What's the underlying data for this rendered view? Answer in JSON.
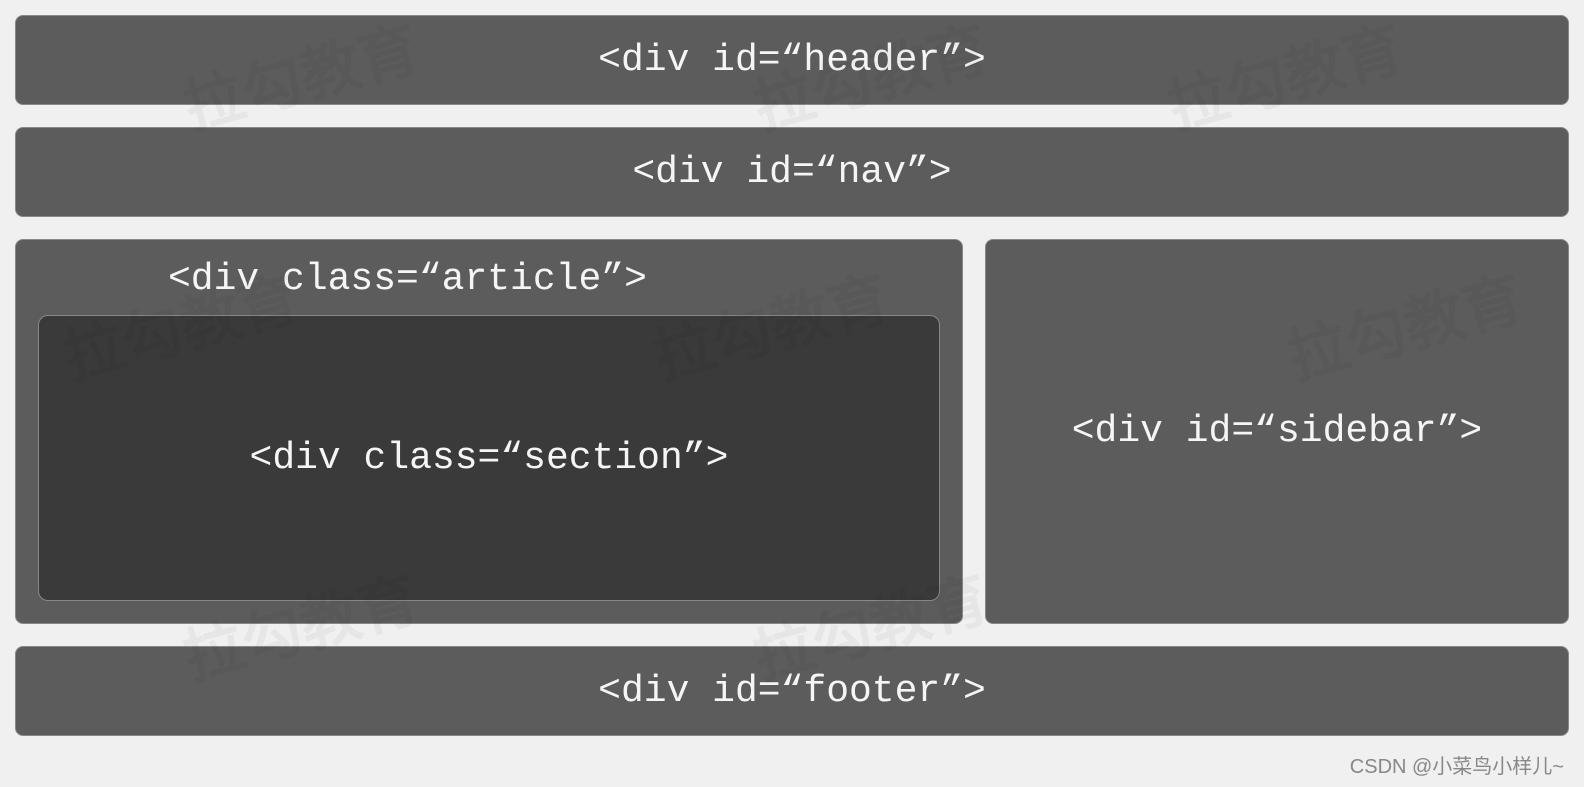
{
  "layout": {
    "header": "<div id=“header”>",
    "nav": "<div id=“nav”>",
    "article": "<div class=“article”>",
    "section": "<div class=“section”>",
    "sidebar": "<div id=“sidebar”>",
    "footer": "<div id=“footer”>"
  },
  "attribution": "CSDN @小菜鸟小样儿~",
  "bg_watermark": "拉勾教育"
}
